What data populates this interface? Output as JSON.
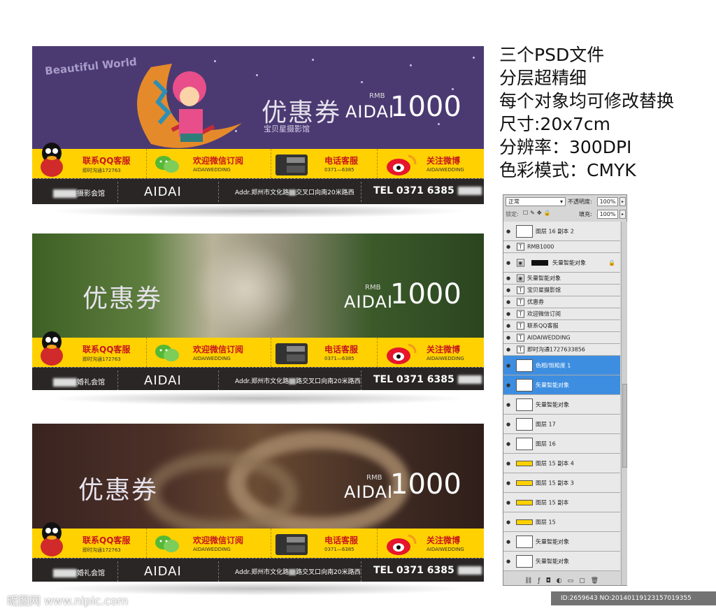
{
  "cards": [
    {
      "coupon": "优惠券",
      "rmb": "RMB",
      "brand": "AIDAI",
      "amount": "1000",
      "subtitle": "宝贝星摄影馆",
      "deco": "Beautiful World",
      "qq_title": "联系QQ客服",
      "qq_sub": "即时沟通172763",
      "wechat_title": "欢迎微信订阅",
      "wechat_sub": "AIDAIWEDDING",
      "phone_title": "电话客服",
      "phone_sub": "0371—6385",
      "weibo_title": "关注微博",
      "weibo_sub": "AIDAIWEDDING",
      "bar_name": "摄影会馆",
      "bar_brand": "AIDAI",
      "bar_addr": "Addr.郑州市文化路",
      "bar_addr2": "交叉口向南20米路西",
      "bar_tel": "TEL 0371 6385"
    },
    {
      "coupon": "优惠券",
      "rmb": "RMB",
      "brand": "AIDAI",
      "amount": "1000",
      "qq_title": "联系QQ客服",
      "qq_sub": "即时沟通172763",
      "wechat_title": "欢迎微信订阅",
      "wechat_sub": "AIDAIWEDDING",
      "phone_title": "电话客服",
      "phone_sub": "0371—6385",
      "weibo_title": "关注微博",
      "weibo_sub": "AIDAIWEDDING",
      "bar_name": "婚礼会馆",
      "bar_brand": "AIDAI",
      "bar_addr": "Addr.郑州市文化路",
      "bar_addr2": "路交叉口向南20米路西",
      "bar_tel": "TEL 0371 6385"
    },
    {
      "coupon": "优惠券",
      "rmb": "RMB",
      "brand": "AIDAI",
      "amount": "1000",
      "qq_title": "联系QQ客服",
      "qq_sub": "即时沟通172763",
      "wechat_title": "欢迎微信订阅",
      "wechat_sub": "AIDAIWEDDING",
      "phone_title": "电话客服",
      "phone_sub": "0371—6385",
      "weibo_title": "关注微博",
      "weibo_sub": "AIDAIWEDDING",
      "bar_name": "婚礼会馆",
      "bar_brand": "AIDAI",
      "bar_addr": "Addr.郑州市文化路",
      "bar_addr2": "路交叉口向南20米路西",
      "bar_tel": "TEL 0371 6385"
    }
  ],
  "info": {
    "line1": "三个PSD文件",
    "line2": "分层超精细",
    "line3": "每个对象均可修改替换",
    "line4": "尺寸:20x7cm",
    "line5": "分辨率：300DPI",
    "line6": "色彩模式：CMYK"
  },
  "layers_panel": {
    "blend_mode": "正常",
    "opacity_label": "不透明度:",
    "opacity_value": "100%",
    "lock_label": "锁定:",
    "fill_label": "填充:",
    "fill_value": "100%",
    "layers": [
      {
        "label": "图层 16 副本 2",
        "kind": "thumb",
        "selected": false
      },
      {
        "label": "RMB1000",
        "kind": "text",
        "selected": false
      },
      {
        "label": "矢量智能对象",
        "kind": "smart-black",
        "selected": false
      },
      {
        "label": "矢量智能对象",
        "kind": "smart",
        "selected": false
      },
      {
        "label": "宝贝星摄影馆",
        "kind": "text",
        "selected": false
      },
      {
        "label": "优惠券",
        "kind": "text",
        "selected": false
      },
      {
        "label": "欢迎微信订阅",
        "kind": "text",
        "selected": false
      },
      {
        "label": "联系QQ客服",
        "kind": "text",
        "selected": false
      },
      {
        "label": "AIDAIWEDDING",
        "kind": "text",
        "selected": false
      },
      {
        "label": "即时沟通1727633856",
        "kind": "text",
        "selected": false
      },
      {
        "label": "色相/饱和度 1",
        "kind": "thumb",
        "selected": true
      },
      {
        "label": "矢量智能对象",
        "kind": "thumb",
        "selected": true
      },
      {
        "label": "矢量智能对象",
        "kind": "thumb",
        "selected": false
      },
      {
        "label": "图层 17",
        "kind": "thumb",
        "selected": false
      },
      {
        "label": "图层 16",
        "kind": "thumb",
        "selected": false
      },
      {
        "label": "图层 15 副本 4",
        "kind": "yellow",
        "selected": false
      },
      {
        "label": "图层 15 副本 3",
        "kind": "yellow",
        "selected": false
      },
      {
        "label": "图层 15 副本",
        "kind": "yellow",
        "selected": false
      },
      {
        "label": "图层 15",
        "kind": "yellow",
        "selected": false
      },
      {
        "label": "矢量智能对象",
        "kind": "thumb",
        "selected": false
      },
      {
        "label": "矢量智能对象",
        "kind": "thumb",
        "selected": false
      }
    ]
  },
  "watermark": "昵图网 www.nipic.com",
  "id_text": "ID:2659643 NO:20140119123157019355",
  "colors": {
    "yellow": "#ffd100",
    "purple": "#4b3a72",
    "red": "#c8161d",
    "dark": "#2a2626",
    "select": "#3d8ee0"
  }
}
